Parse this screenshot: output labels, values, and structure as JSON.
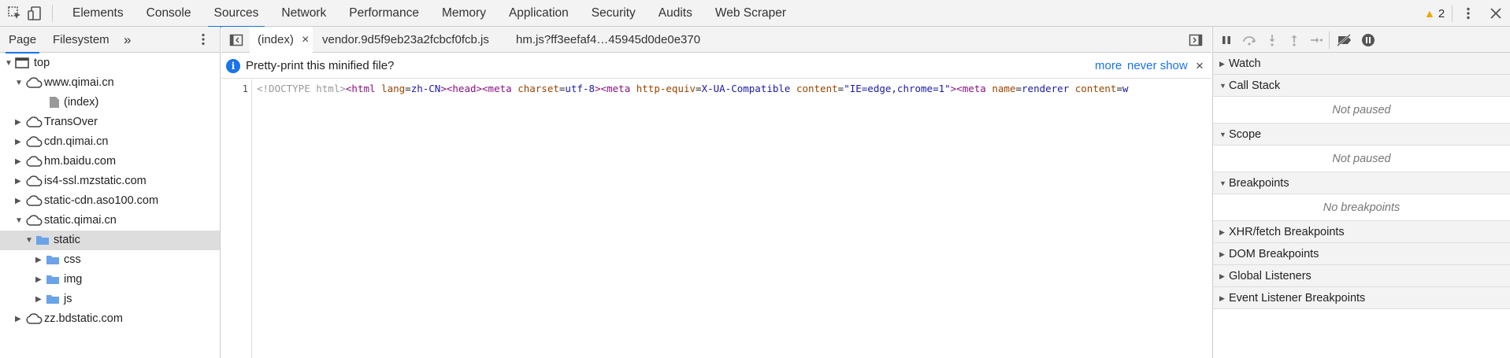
{
  "toolbar": {
    "tabs": [
      "Elements",
      "Console",
      "Sources",
      "Network",
      "Performance",
      "Memory",
      "Application",
      "Security",
      "Audits",
      "Web Scraper"
    ],
    "active_tab": "Sources",
    "warning_count": "2",
    "icons": [
      "inspect-icon",
      "device-toggle-icon",
      "warning-icon",
      "more-options-icon",
      "close-icon"
    ]
  },
  "navigator": {
    "tabs": [
      "Page",
      "Filesystem"
    ],
    "active_tab": "Page",
    "more_tabs_glyph": "»",
    "tree": [
      {
        "label": "top",
        "kind": "frame",
        "expanded": true
      },
      {
        "label": "www.qimai.cn",
        "kind": "domain",
        "expanded": true
      },
      {
        "label": "(index)",
        "kind": "file"
      },
      {
        "label": "TransOver",
        "kind": "domain",
        "expanded": false
      },
      {
        "label": "cdn.qimai.cn",
        "kind": "domain",
        "expanded": false
      },
      {
        "label": "hm.baidu.com",
        "kind": "domain",
        "expanded": false
      },
      {
        "label": "is4-ssl.mzstatic.com",
        "kind": "domain",
        "expanded": false
      },
      {
        "label": "static-cdn.aso100.com",
        "kind": "domain",
        "expanded": false
      },
      {
        "label": "static.qimai.cn",
        "kind": "domain",
        "expanded": true
      },
      {
        "label": "static",
        "kind": "folder",
        "expanded": true,
        "selected": true
      },
      {
        "label": "css",
        "kind": "folder",
        "expanded": false
      },
      {
        "label": "img",
        "kind": "folder",
        "expanded": false
      },
      {
        "label": "js",
        "kind": "folder",
        "expanded": false
      },
      {
        "label": "zz.bdstatic.com",
        "kind": "domain",
        "expanded": false
      }
    ]
  },
  "editor": {
    "tabs": [
      {
        "label": "(index)",
        "closable": true,
        "active": true
      },
      {
        "label": "vendor.9d5f9eb23a2fcbcf0fcb.js",
        "closable": false
      },
      {
        "label": "hm.js?ff3eefaf4…45945d0de0e370",
        "closable": false
      }
    ],
    "close_glyph": "×",
    "infobar": {
      "message": "Pretty-print this minified file?",
      "more_label": "more",
      "never_show_label": "never show",
      "close_glyph": "×"
    },
    "line_number": "1",
    "code_tokens": [
      {
        "t": "<!DOCTYPE html>",
        "c": "c-gray"
      },
      {
        "t": "<html",
        "c": "c-tag"
      },
      {
        "t": " lang",
        "c": "c-attr"
      },
      {
        "t": "=",
        "c": "c-plain"
      },
      {
        "t": "zh-CN",
        "c": "c-val"
      },
      {
        "t": ">",
        "c": "c-tag"
      },
      {
        "t": "<head>",
        "c": "c-tag"
      },
      {
        "t": "<meta",
        "c": "c-tag"
      },
      {
        "t": " charset",
        "c": "c-attr"
      },
      {
        "t": "=",
        "c": "c-plain"
      },
      {
        "t": "utf-8",
        "c": "c-val"
      },
      {
        "t": ">",
        "c": "c-tag"
      },
      {
        "t": "<meta",
        "c": "c-tag"
      },
      {
        "t": " http-equiv",
        "c": "c-attr"
      },
      {
        "t": "=",
        "c": "c-plain"
      },
      {
        "t": "X-UA-Compatible",
        "c": "c-val"
      },
      {
        "t": " content",
        "c": "c-attr"
      },
      {
        "t": "=",
        "c": "c-plain"
      },
      {
        "t": "\"IE=edge,chrome=1\"",
        "c": "c-val"
      },
      {
        "t": ">",
        "c": "c-tag"
      },
      {
        "t": "<meta",
        "c": "c-tag"
      },
      {
        "t": " name",
        "c": "c-attr"
      },
      {
        "t": "=",
        "c": "c-plain"
      },
      {
        "t": "renderer",
        "c": "c-val"
      },
      {
        "t": " content",
        "c": "c-attr"
      },
      {
        "t": "=",
        "c": "c-plain"
      },
      {
        "t": "w",
        "c": "c-val"
      }
    ]
  },
  "debugger": {
    "toolbar_icons": [
      "pause-icon",
      "step-over-icon",
      "step-into-icon",
      "step-out-icon",
      "step-icon",
      "deactivate-breakpoints-icon",
      "pause-on-exceptions-icon"
    ],
    "panes": [
      {
        "title": "Watch",
        "expanded": false
      },
      {
        "title": "Call Stack",
        "expanded": true,
        "body": "Not paused"
      },
      {
        "title": "Scope",
        "expanded": true,
        "body": "Not paused"
      },
      {
        "title": "Breakpoints",
        "expanded": true,
        "body": "No breakpoints"
      },
      {
        "title": "XHR/fetch Breakpoints",
        "expanded": false
      },
      {
        "title": "DOM Breakpoints",
        "expanded": false
      },
      {
        "title": "Global Listeners",
        "expanded": false
      },
      {
        "title": "Event Listener Breakpoints",
        "expanded": false
      }
    ]
  },
  "colors": {
    "accent": "#1a73e8",
    "warning": "#f2a600",
    "folder": "#6aa3e8",
    "toolbar_bg": "#f3f3f3"
  }
}
